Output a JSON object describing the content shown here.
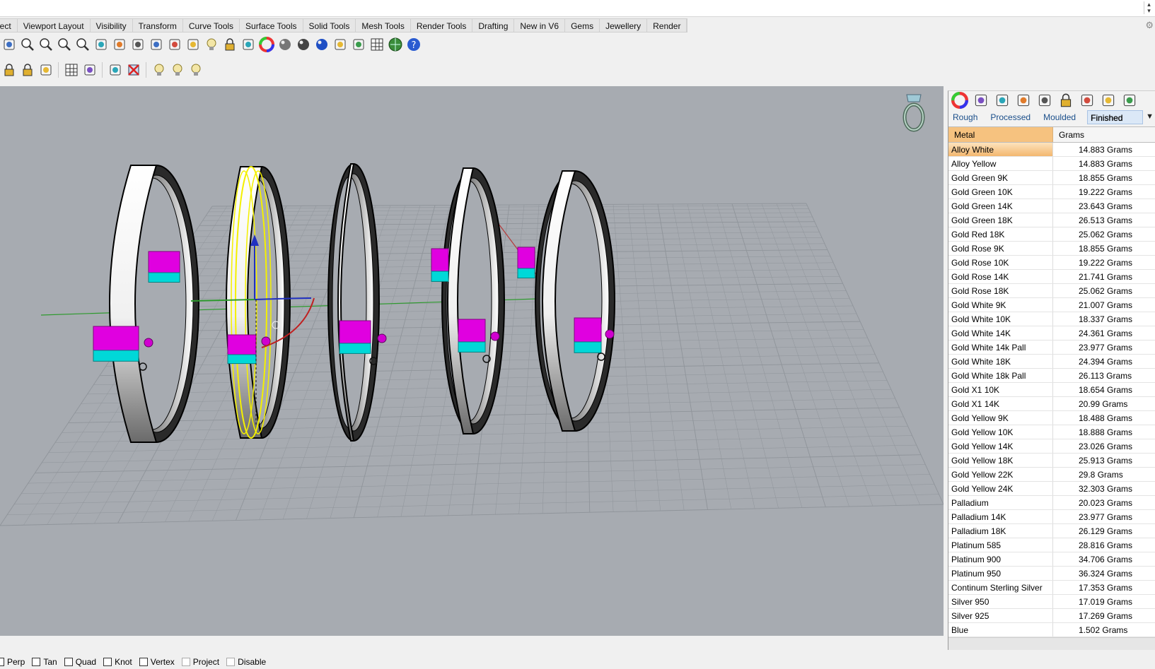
{
  "tabs": [
    "lect",
    "Viewport Layout",
    "Visibility",
    "Transform",
    "Curve Tools",
    "Surface Tools",
    "Solid Tools",
    "Mesh Tools",
    "Render Tools",
    "Drafting",
    "New in V6",
    "Gems",
    "Jewellery",
    "Render"
  ],
  "toolbar1_icons": [
    "pan-icon",
    "zoom-icon",
    "zoom-window-icon",
    "zoom-extents-icon",
    "zoom-selected-icon",
    "rotate-view-icon",
    "four-viewports-icon",
    "car-icon",
    "car-gray-icon",
    "circle-gray-icon",
    "named-view-icon",
    "lightbulb-icon",
    "lock-icon",
    "shield-icon",
    "color-wheel-icon",
    "shaded-sphere-icon",
    "rendered-sphere-icon",
    "blue-sphere-icon",
    "pen-icon",
    "gears-icon",
    "snap-grid-icon",
    "globe-icon",
    "help-icon"
  ],
  "toolbar2_icons": [
    "padlock-icon",
    "copy-lock-icon",
    "swap-icon",
    "select-grid-icon",
    "select-dotted-icon",
    "pick-icon",
    "delete-icon",
    "light-1-icon",
    "light-2-icon",
    "light-3-icon"
  ],
  "panel": {
    "icons": [
      "color-wheel-icon",
      "shield-icon",
      "monitor-icon",
      "rg-icon",
      "gem-icon",
      "clock-icon",
      "box-icon",
      "ring-icon",
      "gear-icon"
    ],
    "subtabs": [
      "Rough",
      "Processed",
      "Moulded",
      "Finished"
    ],
    "active_subtab": "Finished",
    "columns": [
      "Metal",
      "Grams"
    ],
    "rows": [
      [
        "Alloy White",
        "14.883 Grams"
      ],
      [
        "Alloy Yellow",
        "14.883 Grams"
      ],
      [
        "Gold Green 9K",
        "18.855 Grams"
      ],
      [
        "Gold Green 10K",
        "19.222 Grams"
      ],
      [
        "Gold Green 14K",
        "23.643 Grams"
      ],
      [
        "Gold Green 18K",
        "26.513 Grams"
      ],
      [
        "Gold Red 18K",
        "25.062 Grams"
      ],
      [
        "Gold Rose 9K",
        "18.855 Grams"
      ],
      [
        "Gold Rose 10K",
        "19.222 Grams"
      ],
      [
        "Gold Rose 14K",
        "21.741 Grams"
      ],
      [
        "Gold Rose 18K",
        "25.062 Grams"
      ],
      [
        "Gold White 9K",
        "21.007 Grams"
      ],
      [
        "Gold White 10K",
        "18.337 Grams"
      ],
      [
        "Gold White 14K",
        "24.361 Grams"
      ],
      [
        "Gold White 14k Pall",
        "23.977 Grams"
      ],
      [
        "Gold White 18K",
        "24.394 Grams"
      ],
      [
        "Gold White 18k Pall",
        "26.113 Grams"
      ],
      [
        "Gold X1 10K",
        "18.654 Grams"
      ],
      [
        "Gold X1 14K",
        "20.99 Grams"
      ],
      [
        "Gold Yellow 9K",
        "18.488 Grams"
      ],
      [
        "Gold Yellow 10K",
        "18.888 Grams"
      ],
      [
        "Gold Yellow 14K",
        "23.026 Grams"
      ],
      [
        "Gold Yellow 18K",
        "25.913 Grams"
      ],
      [
        "Gold Yellow 22K",
        "29.8 Grams"
      ],
      [
        "Gold Yellow 24K",
        "32.303 Grams"
      ],
      [
        "Palladium",
        "20.023 Grams"
      ],
      [
        "Palladium 14K",
        "23.977 Grams"
      ],
      [
        "Palladium 18K",
        "26.129 Grams"
      ],
      [
        "Platinum 585",
        "28.816 Grams"
      ],
      [
        "Platinum 900",
        "34.706 Grams"
      ],
      [
        "Platinum 950",
        "36.324 Grams"
      ],
      [
        "Continum Sterling Silver",
        "17.353 Grams"
      ],
      [
        "Silver 950",
        "17.019 Grams"
      ],
      [
        "Silver 925",
        "17.269 Grams"
      ],
      [
        "Blue",
        "1.502 Grams"
      ]
    ],
    "selected_row": "Alloy White"
  },
  "statusbar": {
    "osnaps": [
      {
        "label": "Perp",
        "dim": false
      },
      {
        "label": "Tan",
        "dim": false
      },
      {
        "label": "Quad",
        "dim": false
      },
      {
        "label": "Knot",
        "dim": false
      },
      {
        "label": "Vertex",
        "dim": false
      },
      {
        "label": "Project",
        "dim": true
      },
      {
        "label": "Disable",
        "dim": true
      }
    ]
  },
  "colors": {
    "viewport_bg": "#a7abb1",
    "selection_yellow": "#f4f000",
    "header_orange": "#f6c27f",
    "magenta": "#e000e0",
    "cyan": "#00d8d8"
  }
}
